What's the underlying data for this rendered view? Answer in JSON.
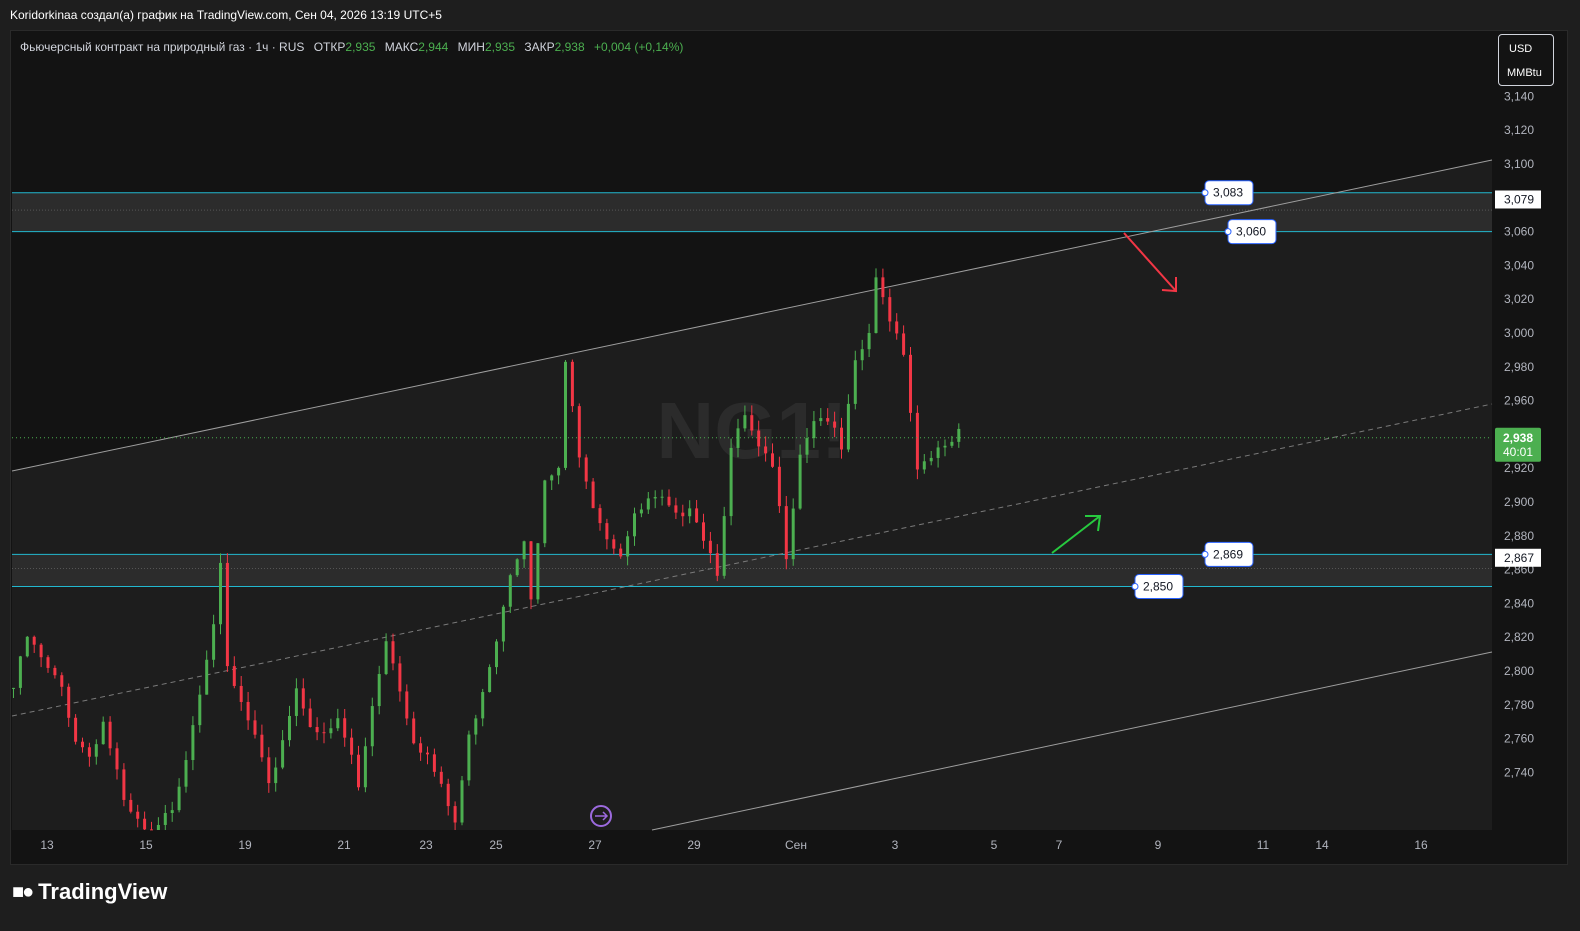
{
  "header": {
    "caption": "Koridorkinaa создал(а) график на TradingView.com, Сен 04, 2026 13:19 UTC+5"
  },
  "legend": {
    "symbol": "Фьючерсный контракт на природный газ · 1ч · RUS",
    "open_label": "ОТКР",
    "open_value": "2,935",
    "high_label": "МАКС",
    "high_value": "2,944",
    "low_label": "МИН",
    "low_value": "2,935",
    "close_label": "ЗАКР",
    "close_value": "2,938",
    "change": "+0,004 (+0,14%)"
  },
  "unit": {
    "currency": "USD",
    "measure": "MMBtu"
  },
  "watermark": "NG1!",
  "footer": {
    "brand": "TradingView",
    "logo_icon": "tradingview-logo-icon"
  },
  "colors": {
    "up": "#26a69a",
    "up_bright": "#4caf50",
    "down": "#f23645",
    "zone_line": "#22b8cf",
    "channel": "#9e9e9e",
    "last_price_bg": "#4caf50"
  },
  "chart_data": {
    "type": "candlestick",
    "ylim": [
      2.71,
      3.19
    ],
    "y_ticks": [
      "3,140",
      "3,120",
      "3,100",
      "3,080",
      "3,060",
      "3,040",
      "3,020",
      "3,000",
      "2,980",
      "2,960",
      "2,940",
      "2,920",
      "2,900",
      "2,880",
      "2,860",
      "2,840",
      "2,820",
      "2,800",
      "2,780",
      "2,760",
      "2,740"
    ],
    "y_tick_values": [
      3.14,
      3.12,
      3.1,
      3.08,
      3.06,
      3.04,
      3.02,
      3.0,
      2.98,
      2.96,
      2.94,
      2.92,
      2.9,
      2.88,
      2.86,
      2.84,
      2.82,
      2.8,
      2.78,
      2.76,
      2.74
    ],
    "x_ticks": [
      "13",
      "15",
      "19",
      "21",
      "23",
      "25",
      "27",
      "29",
      "Сен",
      "3",
      "5",
      "7",
      "9",
      "11",
      "14",
      "16"
    ],
    "last_price": {
      "value": "2,938",
      "countdown": "40:01",
      "y": 2.938
    },
    "zones": [
      {
        "top": 3.083,
        "bottom": 3.06,
        "top_label": "3,083",
        "bottom_label": "3,060",
        "axis_label": "3,079",
        "axis_value": 3.079
      },
      {
        "top": 2.869,
        "bottom": 2.85,
        "top_label": "2,869",
        "bottom_label": "2,850",
        "axis_label": "2,867",
        "axis_value": 2.867
      }
    ],
    "price_path": [
      [
        0,
        2.79
      ],
      [
        2,
        2.82
      ],
      [
        5,
        2.8
      ],
      [
        7,
        2.79
      ],
      [
        9,
        2.76
      ],
      [
        11,
        2.75
      ],
      [
        13,
        2.77
      ],
      [
        15,
        2.74
      ],
      [
        16,
        2.72
      ],
      [
        20,
        2.7
      ],
      [
        23,
        2.72
      ],
      [
        25,
        2.75
      ],
      [
        27,
        2.79
      ],
      [
        29,
        2.83
      ],
      [
        30,
        2.86
      ],
      [
        31,
        2.8
      ],
      [
        33,
        2.78
      ],
      [
        35,
        2.76
      ],
      [
        37,
        2.73
      ],
      [
        39,
        2.76
      ],
      [
        41,
        2.79
      ],
      [
        43,
        2.77
      ],
      [
        45,
        2.76
      ],
      [
        47,
        2.77
      ],
      [
        49,
        2.75
      ],
      [
        50,
        2.73
      ],
      [
        52,
        2.78
      ],
      [
        54,
        2.82
      ],
      [
        56,
        2.79
      ],
      [
        58,
        2.76
      ],
      [
        60,
        2.75
      ],
      [
        62,
        2.73
      ],
      [
        64,
        2.71
      ],
      [
        66,
        2.76
      ],
      [
        68,
        2.79
      ],
      [
        70,
        2.82
      ],
      [
        72,
        2.86
      ],
      [
        74,
        2.88
      ],
      [
        75,
        2.84
      ],
      [
        77,
        2.91
      ],
      [
        79,
        2.92
      ],
      [
        80,
        2.98
      ],
      [
        82,
        2.93
      ],
      [
        84,
        2.9
      ],
      [
        86,
        2.88
      ],
      [
        88,
        2.87
      ],
      [
        90,
        2.89
      ],
      [
        92,
        2.9
      ],
      [
        94,
        2.9
      ],
      [
        96,
        2.89
      ],
      [
        98,
        2.9
      ],
      [
        100,
        2.88
      ],
      [
        102,
        2.86
      ],
      [
        104,
        2.93
      ],
      [
        106,
        2.95
      ],
      [
        108,
        2.93
      ],
      [
        110,
        2.92
      ],
      [
        112,
        2.87
      ],
      [
        114,
        2.93
      ],
      [
        116,
        2.95
      ],
      [
        118,
        2.95
      ],
      [
        120,
        2.93
      ],
      [
        122,
        2.98
      ],
      [
        124,
        3.0
      ],
      [
        125,
        3.03
      ],
      [
        127,
        3.01
      ],
      [
        129,
        2.99
      ],
      [
        131,
        2.92
      ],
      [
        133,
        2.93
      ],
      [
        135,
        2.93
      ],
      [
        137,
        2.94
      ]
    ]
  }
}
